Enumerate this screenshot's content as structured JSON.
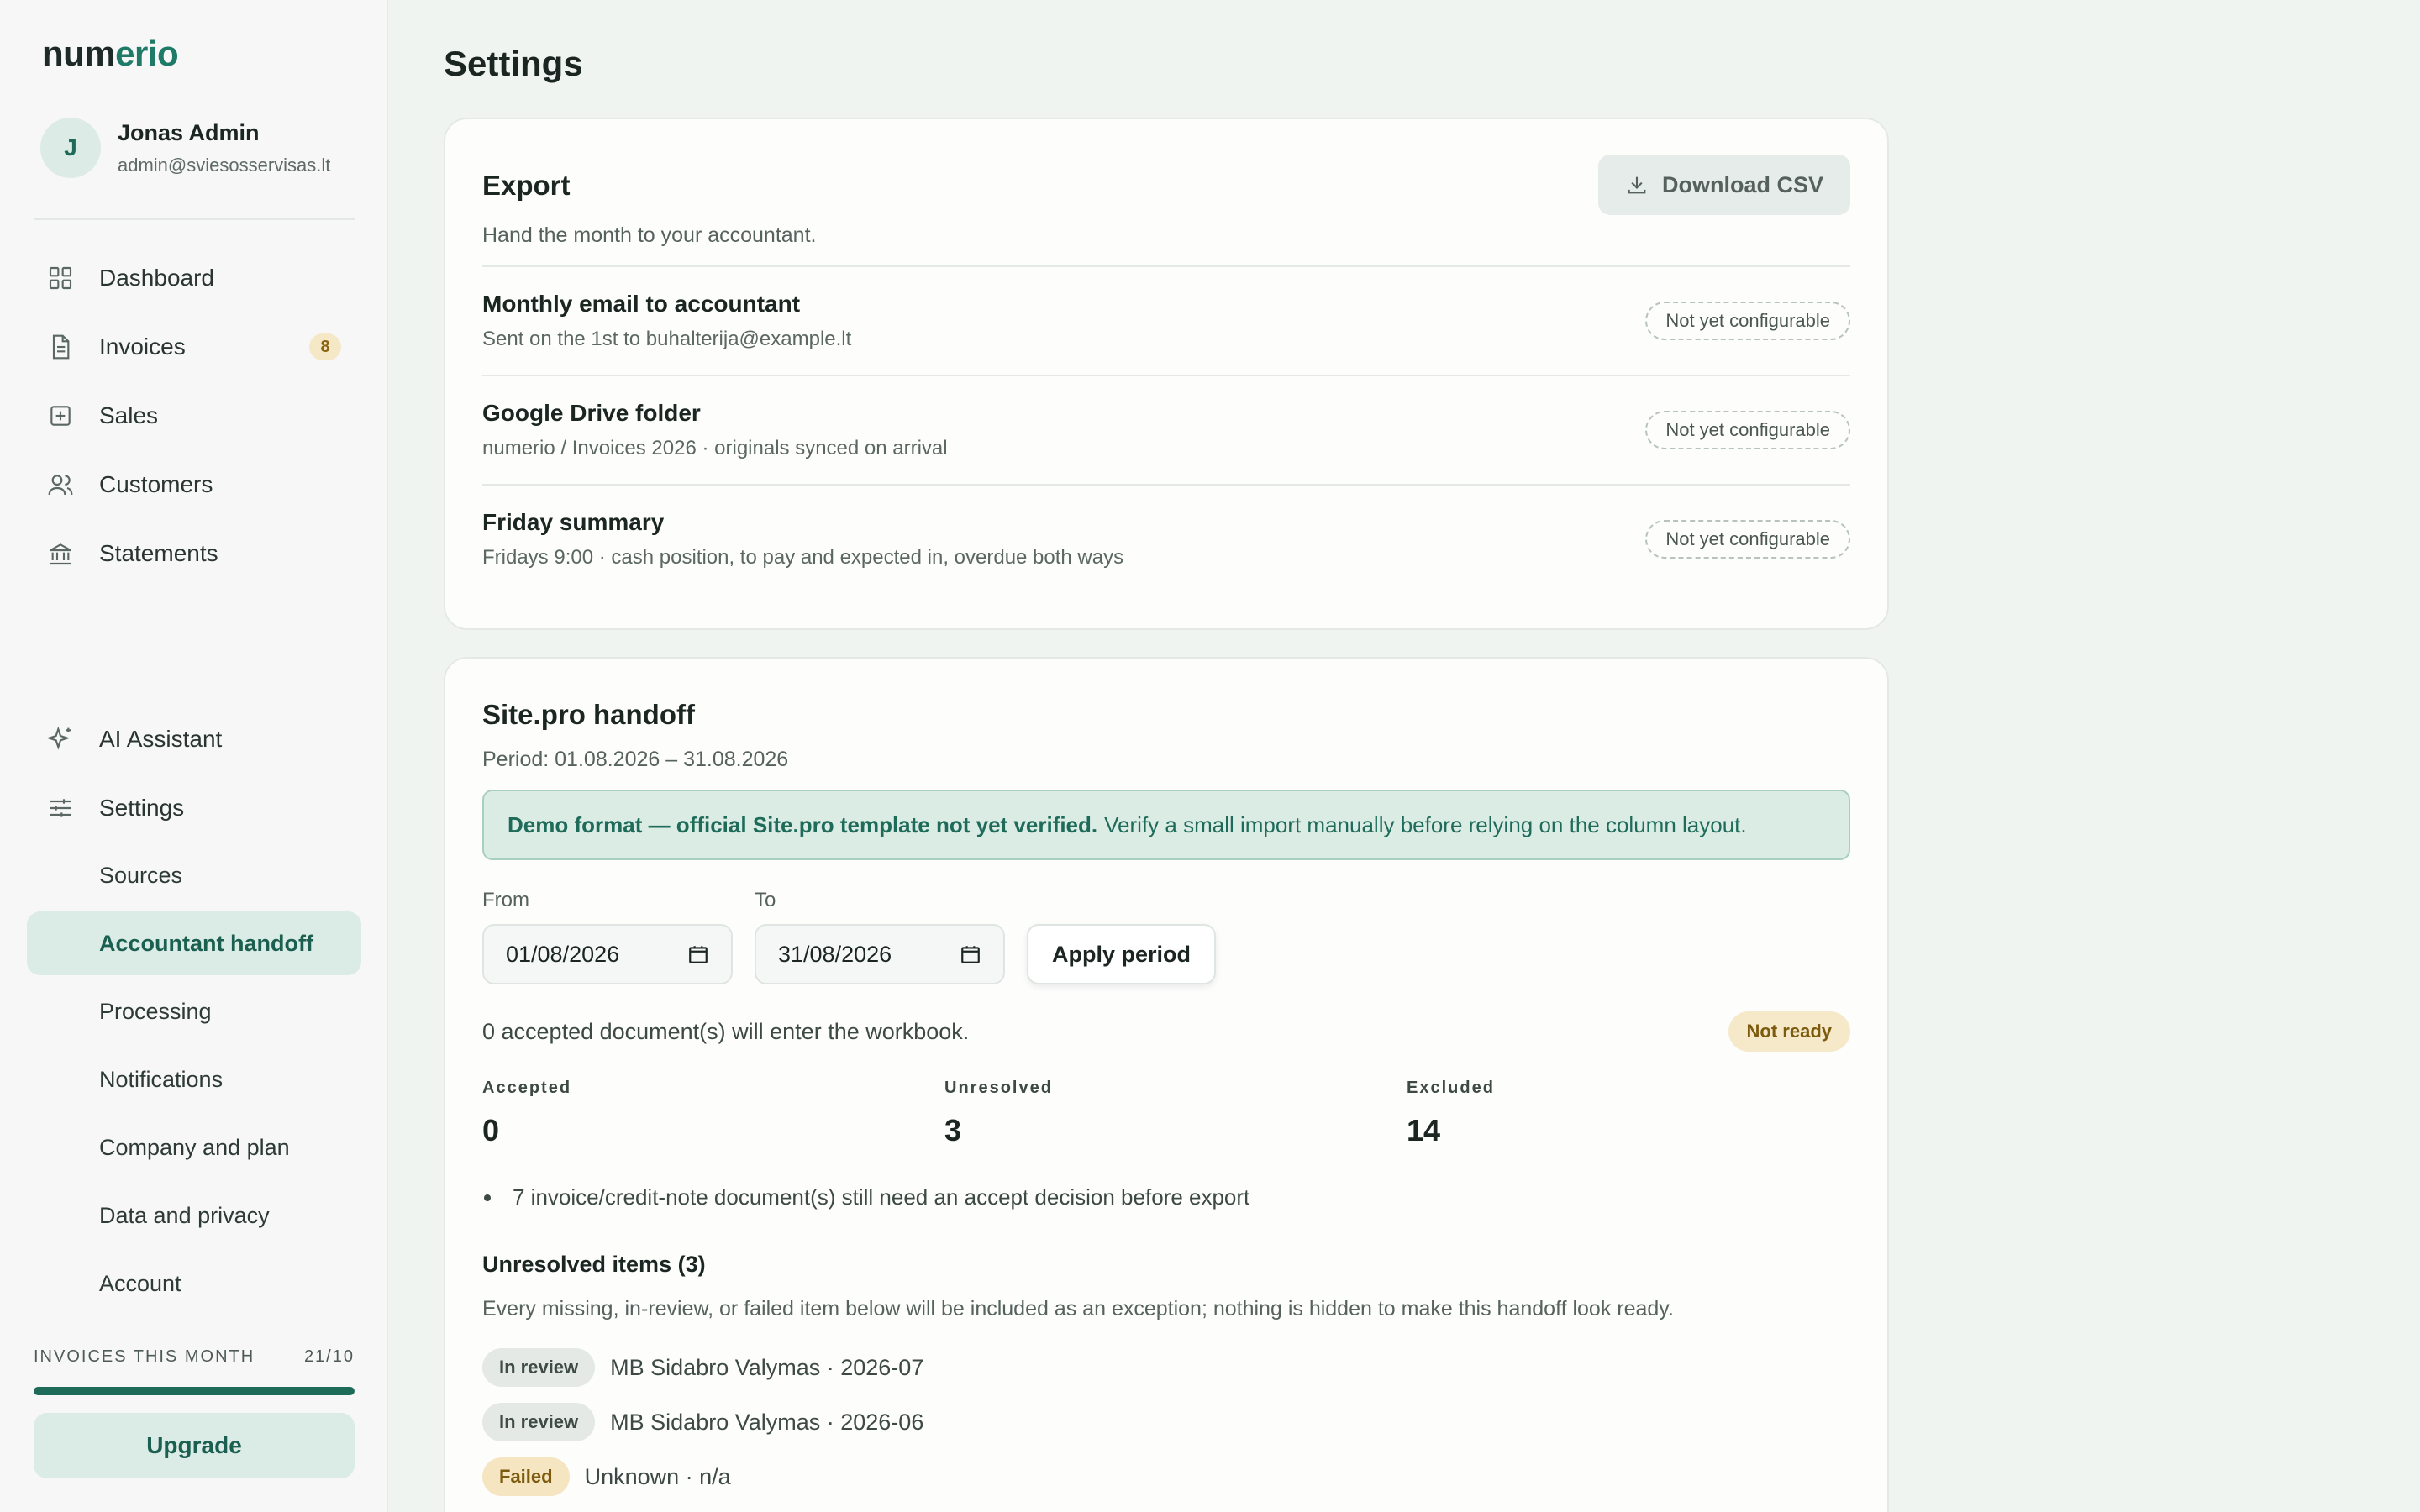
{
  "brand": {
    "prefix": "num",
    "accent": "erio",
    "accent_color": "#1f7a67"
  },
  "user": {
    "initial": "J",
    "name": "Jonas Admin",
    "email": "admin@sviesosservisas.lt"
  },
  "nav": {
    "items": [
      {
        "label": "Dashboard",
        "icon": "grid-icon"
      },
      {
        "label": "Invoices",
        "icon": "document-icon",
        "badge": "8"
      },
      {
        "label": "Sales",
        "icon": "plus-square-icon"
      },
      {
        "label": "Customers",
        "icon": "users-icon"
      },
      {
        "label": "Statements",
        "icon": "bank-icon"
      }
    ],
    "secondary": [
      {
        "label": "AI Assistant",
        "icon": "sparkle-icon"
      },
      {
        "label": "Settings",
        "icon": "sliders-icon"
      }
    ],
    "settings_sub": [
      {
        "label": "Sources"
      },
      {
        "label": "Accountant handoff",
        "active": true
      },
      {
        "label": "Processing"
      },
      {
        "label": "Notifications"
      },
      {
        "label": "Company and plan"
      },
      {
        "label": "Data and privacy"
      },
      {
        "label": "Account"
      }
    ]
  },
  "quota": {
    "label": "INVOICES THIS MONTH",
    "value": "21/10",
    "progress": 1.0
  },
  "upgrade_label": "Upgrade",
  "page_title": "Settings",
  "export": {
    "title": "Export",
    "subtitle": "Hand the month to your accountant.",
    "download_label": "Download CSV",
    "rows": [
      {
        "title": "Monthly email to accountant",
        "desc": "Sent on the 1st to buhalterija@example.lt",
        "status": "Not yet configurable"
      },
      {
        "title": "Google Drive folder",
        "desc": "numerio / Invoices 2026 · originals synced on arrival",
        "status": "Not yet configurable"
      },
      {
        "title": "Friday summary",
        "desc": "Fridays 9:00 · cash position, to pay and expected in, overdue both ways",
        "status": "Not yet configurable"
      }
    ]
  },
  "handoff": {
    "title": "Site.pro handoff",
    "period": "Period: 01.08.2026 – 31.08.2026",
    "notice_bold": "Demo format — official Site.pro template not yet verified.",
    "notice_text": "Verify a small import manually before relying on the column layout.",
    "from_label": "From",
    "from_value": "01/08/2026",
    "to_label": "To",
    "to_value": "31/08/2026",
    "apply_label": "Apply period",
    "workbook_text": "0 accepted document(s) will enter the workbook.",
    "readiness": "Not ready",
    "stats": [
      {
        "label": "Accepted",
        "value": "0"
      },
      {
        "label": "Unresolved",
        "value": "3"
      },
      {
        "label": "Excluded",
        "value": "14"
      }
    ],
    "bullet": "7 invoice/credit-note document(s) still need an accept decision before export",
    "unresolved_title": "Unresolved items (3)",
    "unresolved_desc": "Every missing, in-review, or failed item below will be included as an exception; nothing is hidden to make this handoff look ready.",
    "items": [
      {
        "status": "In review",
        "text": "MB Sidabro Valymas · 2026-07"
      },
      {
        "status": "In review",
        "text": "MB Sidabro Valymas · 2026-06"
      },
      {
        "status": "Failed",
        "text": "Unknown · n/a"
      }
    ]
  }
}
